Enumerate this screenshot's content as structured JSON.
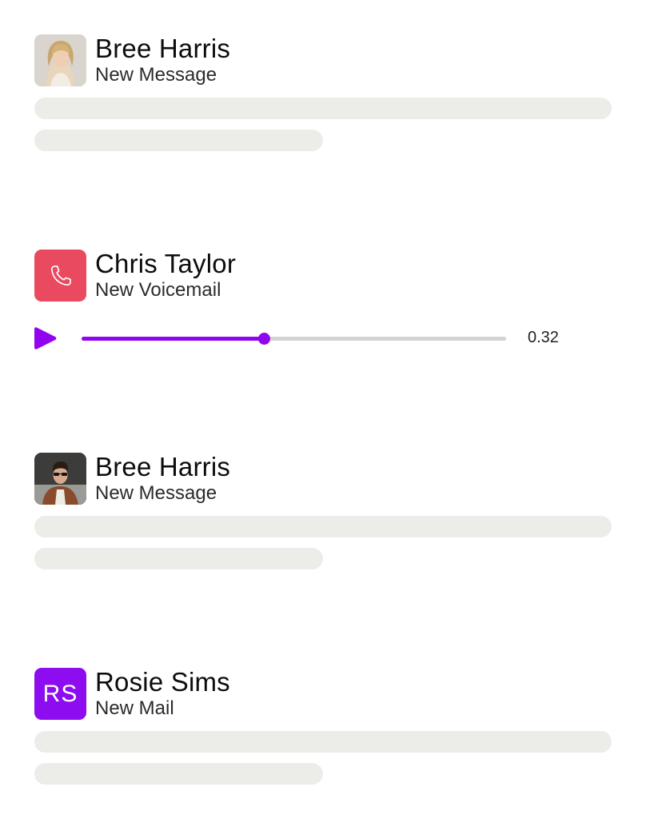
{
  "notifications": [
    {
      "name": "Bree Harris",
      "subtitle": "New Message",
      "avatar": "woman-portrait-photo"
    },
    {
      "name": "Chris Taylor",
      "subtitle": "New Voicemail",
      "avatar": "phone-icon",
      "avatar_color": "#e94a5f"
    },
    {
      "name": "Bree Harris",
      "subtitle": "New Message",
      "avatar": "man-portrait-photo"
    },
    {
      "name": "Rosie Sims",
      "subtitle": "New Mail",
      "avatar_initials": "RS",
      "avatar_color": "#8d0cf0"
    }
  ],
  "voicemail_player": {
    "time": "0.32",
    "progress": 0.43,
    "accent_color": "#9005ee",
    "play_icon": "play-icon"
  },
  "placeholder_color": "#ecece8"
}
